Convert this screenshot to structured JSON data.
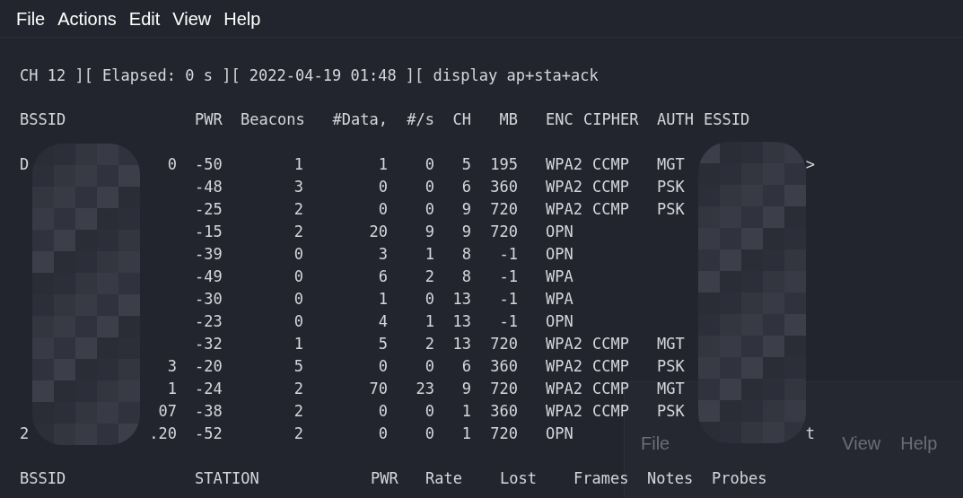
{
  "menu": [
    "File",
    "Actions",
    "Edit",
    "View",
    "Help"
  ],
  "status_line": "CH 12 ][ Elapsed: 0 s ][ 2022-04-19 01:48 ][ display ap+sta+ack",
  "ap_columns": [
    "BSSID",
    "PWR",
    "Beacons",
    "#Data,",
    "#/s",
    "CH",
    "MB",
    "ENC",
    "CIPHER",
    "AUTH",
    "ESSID"
  ],
  "ap_rows": [
    {
      "bssid_start": "D",
      "bssid_end": "0",
      "pwr": "-50",
      "beacons": "1",
      "data": "1",
      "rate": "0",
      "ch": "5",
      "mb": "195",
      "enc": "WPA2",
      "cipher": "CCMP",
      "auth": "MGT",
      "essid_end": ">"
    },
    {
      "pwr": "-48",
      "beacons": "3",
      "data": "0",
      "rate": "0",
      "ch": "6",
      "mb": "360",
      "enc": "WPA2",
      "cipher": "CCMP",
      "auth": "PSK"
    },
    {
      "pwr": "-25",
      "beacons": "2",
      "data": "0",
      "rate": "0",
      "ch": "9",
      "mb": "720",
      "enc": "WPA2",
      "cipher": "CCMP",
      "auth": "PSK"
    },
    {
      "pwr": "-15",
      "beacons": "2",
      "data": "20",
      "rate": "9",
      "ch": "9",
      "mb": "720",
      "enc": "OPN"
    },
    {
      "pwr": "-39",
      "beacons": "0",
      "data": "3",
      "rate": "1",
      "ch": "8",
      "mb": "-1",
      "enc": "OPN"
    },
    {
      "pwr": "-49",
      "beacons": "0",
      "data": "6",
      "rate": "2",
      "ch": "8",
      "mb": "-1",
      "enc": "WPA"
    },
    {
      "pwr": "-30",
      "beacons": "0",
      "data": "1",
      "rate": "0",
      "ch": "13",
      "mb": "-1",
      "enc": "WPA"
    },
    {
      "pwr": "-23",
      "beacons": "0",
      "data": "4",
      "rate": "1",
      "ch": "13",
      "mb": "-1",
      "enc": "OPN"
    },
    {
      "pwr": "-32",
      "beacons": "1",
      "data": "5",
      "rate": "2",
      "ch": "13",
      "mb": "720",
      "enc": "WPA2",
      "cipher": "CCMP",
      "auth": "MGT"
    },
    {
      "bssid_end": "3",
      "pwr": "-20",
      "beacons": "5",
      "data": "0",
      "rate": "0",
      "ch": "6",
      "mb": "360",
      "enc": "WPA2",
      "cipher": "CCMP",
      "auth": "PSK"
    },
    {
      "bssid_end": "1",
      "pwr": "-24",
      "beacons": "2",
      "data": "70",
      "rate": "23",
      "ch": "9",
      "mb": "720",
      "enc": "WPA2",
      "cipher": "CCMP",
      "auth": "MGT"
    },
    {
      "bssid_end": "07",
      "pwr": "-38",
      "beacons": "2",
      "data": "0",
      "rate": "0",
      "ch": "1",
      "mb": "360",
      "enc": "WPA2",
      "cipher": "CCMP",
      "auth": "PSK"
    },
    {
      "bssid_start": "2",
      "bssid_end": ".20",
      "pwr": "-52",
      "beacons": "2",
      "data": "0",
      "rate": "0",
      "ch": "1",
      "mb": "720",
      "enc": "OPN",
      "essid_end": "t"
    }
  ],
  "station_columns": [
    "BSSID",
    "STATION",
    "PWR",
    "Rate",
    "Lost",
    "Frames",
    "Notes",
    "Probes"
  ],
  "ghost_window": {
    "menu": [
      "File",
      "View",
      "Help"
    ]
  }
}
